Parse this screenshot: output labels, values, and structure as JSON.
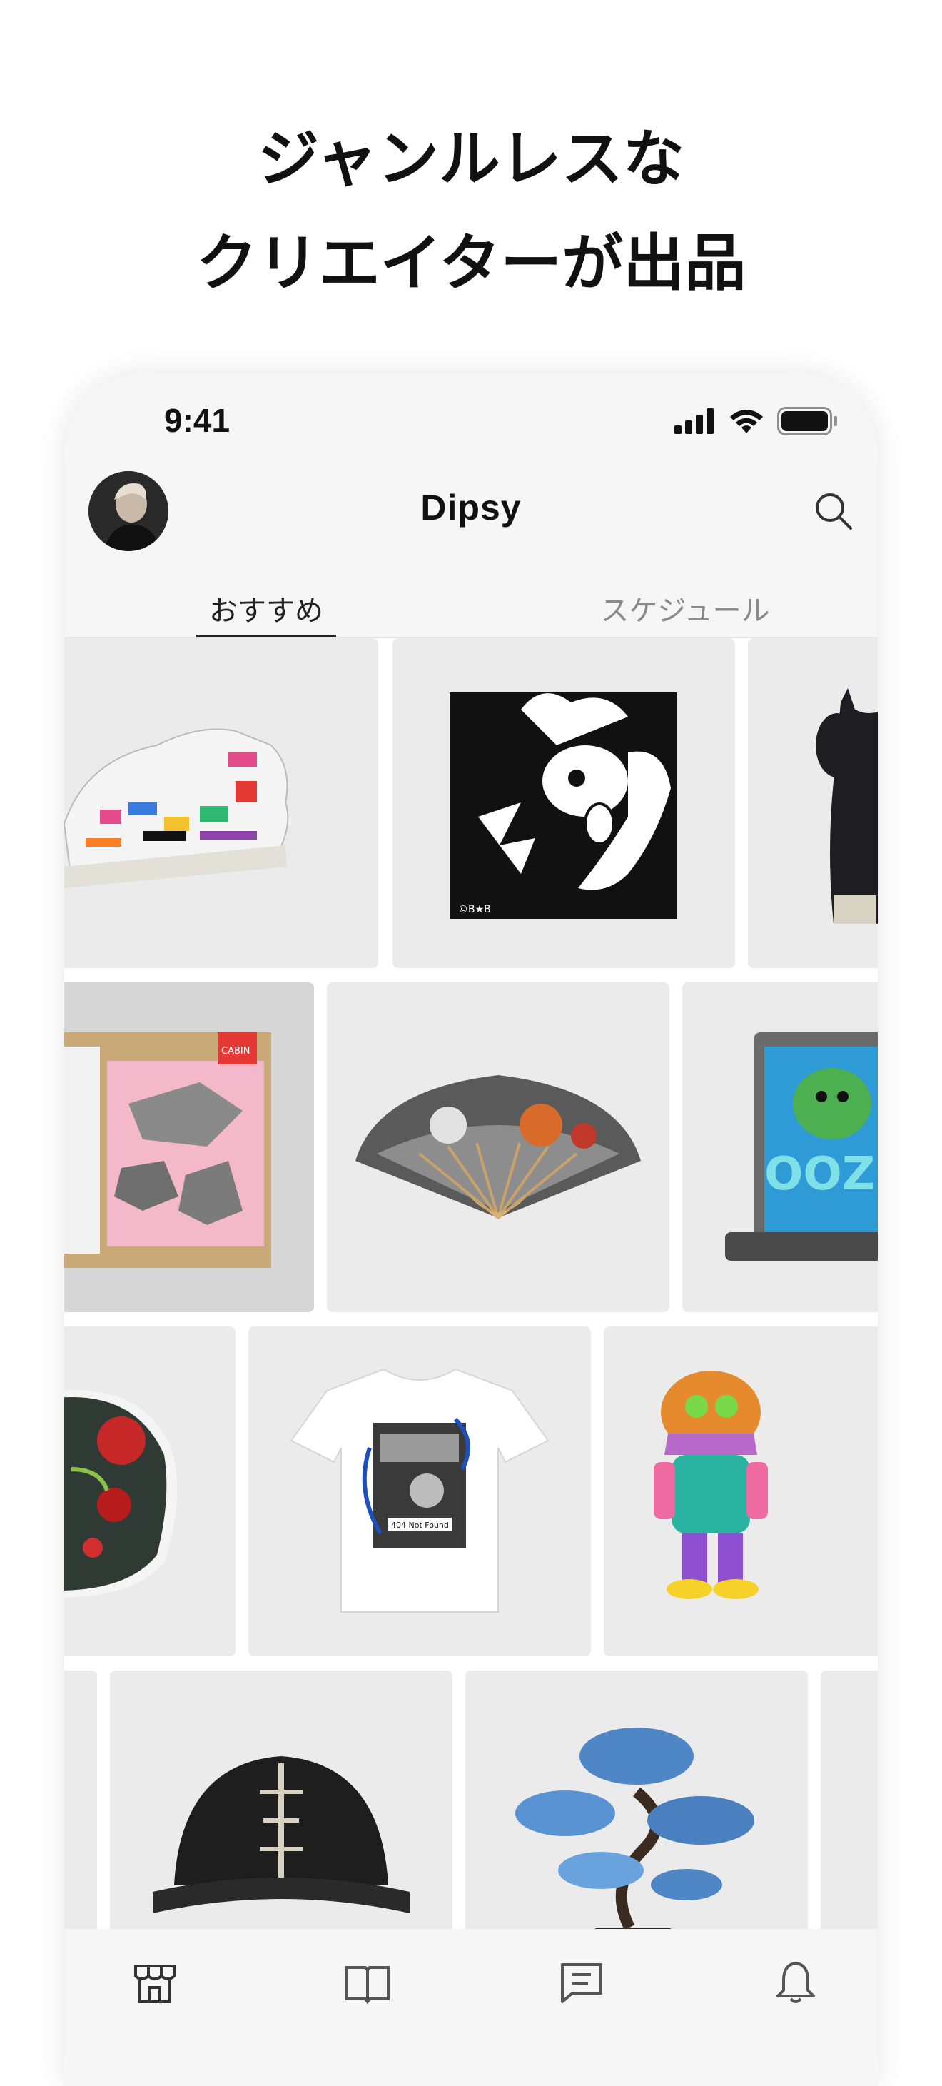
{
  "promo": {
    "line1": "ジャンルレスな",
    "line2": "クリエイターが出品"
  },
  "status_bar": {
    "time": "9:41",
    "icons": [
      "cellular-signal-icon",
      "wifi-icon",
      "battery-icon"
    ]
  },
  "header": {
    "logo": "Dipsy",
    "avatar": "profile-avatar",
    "search_icon": "search-icon"
  },
  "tabs": [
    {
      "label": "おすすめ",
      "selected": true
    },
    {
      "label": "スケジュール",
      "selected": false
    }
  ],
  "products": [
    {
      "name": "graffiti-sneaker-image"
    },
    {
      "name": "black-white-cartoon-art-image"
    },
    {
      "name": "black-figure-image"
    },
    {
      "name": "rock-collage-art-image"
    },
    {
      "name": "folding-fan-image"
    },
    {
      "name": "slabbed-card-image"
    },
    {
      "name": "peony-art-image"
    },
    {
      "name": "printed-tshirt-image"
    },
    {
      "name": "colorful-figure-image"
    },
    {
      "name": "black-cap-image"
    },
    {
      "name": "bonsai-image"
    }
  ],
  "cards": {
    "card1_label": "©B★B",
    "cabin_label": "CABIN",
    "shirt_label": "404 Not Found",
    "ooze_label": "OOZE"
  },
  "bottom_nav": [
    {
      "icon": "store-icon",
      "selected": true
    },
    {
      "icon": "book-icon",
      "selected": false
    },
    {
      "icon": "message-icon",
      "selected": false
    },
    {
      "icon": "bell-icon",
      "selected": false
    }
  ],
  "colors": {
    "background": "#ffffff",
    "phone_bg": "#f6f6f6",
    "card_bg": "#ebebeb",
    "text_primary": "#111111",
    "text_secondary": "#8a8a8a"
  }
}
